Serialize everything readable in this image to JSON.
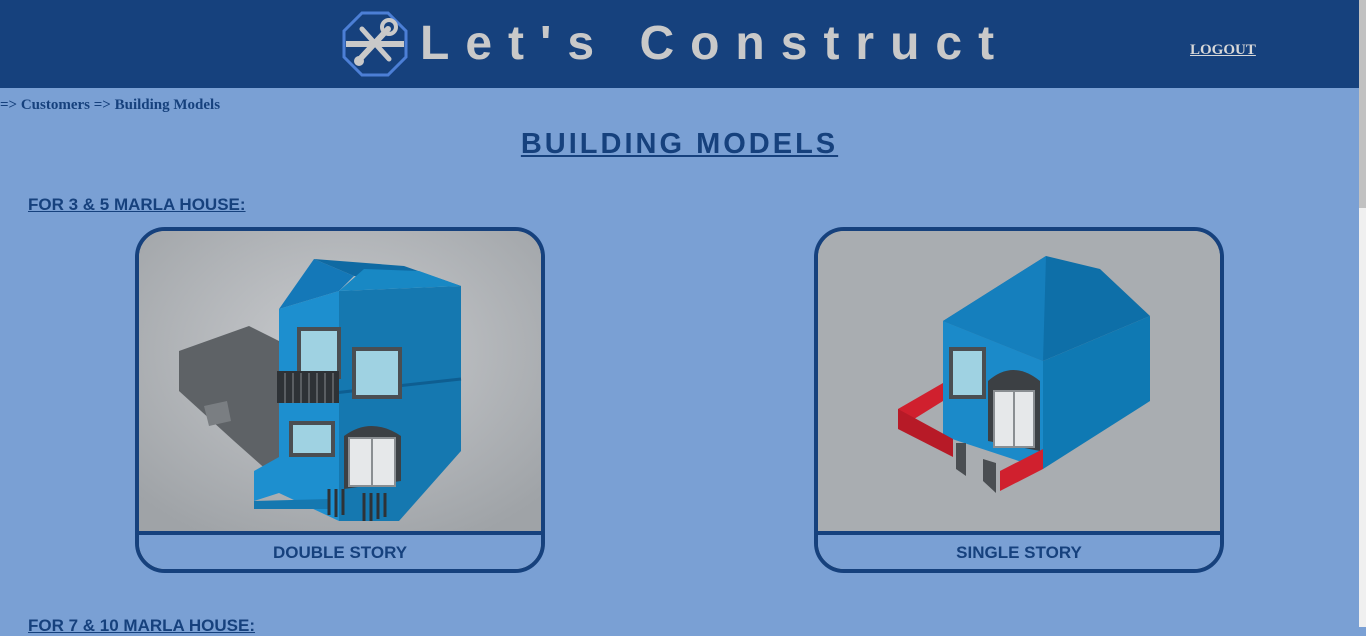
{
  "header": {
    "logo_icon": "wrench-screwdriver-icon",
    "title": "Let's Construct",
    "logout_label": "LOGOUT"
  },
  "breadcrumb": "=> Customers => Building Models",
  "page_title": "BUILDING MODELS",
  "sections": [
    {
      "heading": "FOR 3 & 5 MARLA HOUSE:",
      "cards": [
        {
          "label": "DOUBLE STORY",
          "image": "double-story-house"
        },
        {
          "label": "SINGLE STORY",
          "image": "single-story-house"
        }
      ]
    },
    {
      "heading": "FOR 7 & 10 MARLA HOUSE:"
    }
  ],
  "colors": {
    "header_bg": "#16417d",
    "page_bg": "#7aa0d4",
    "text_primary": "#16417d",
    "house_blue": "#1d8fcf",
    "wall_red": "#c81f2e"
  }
}
